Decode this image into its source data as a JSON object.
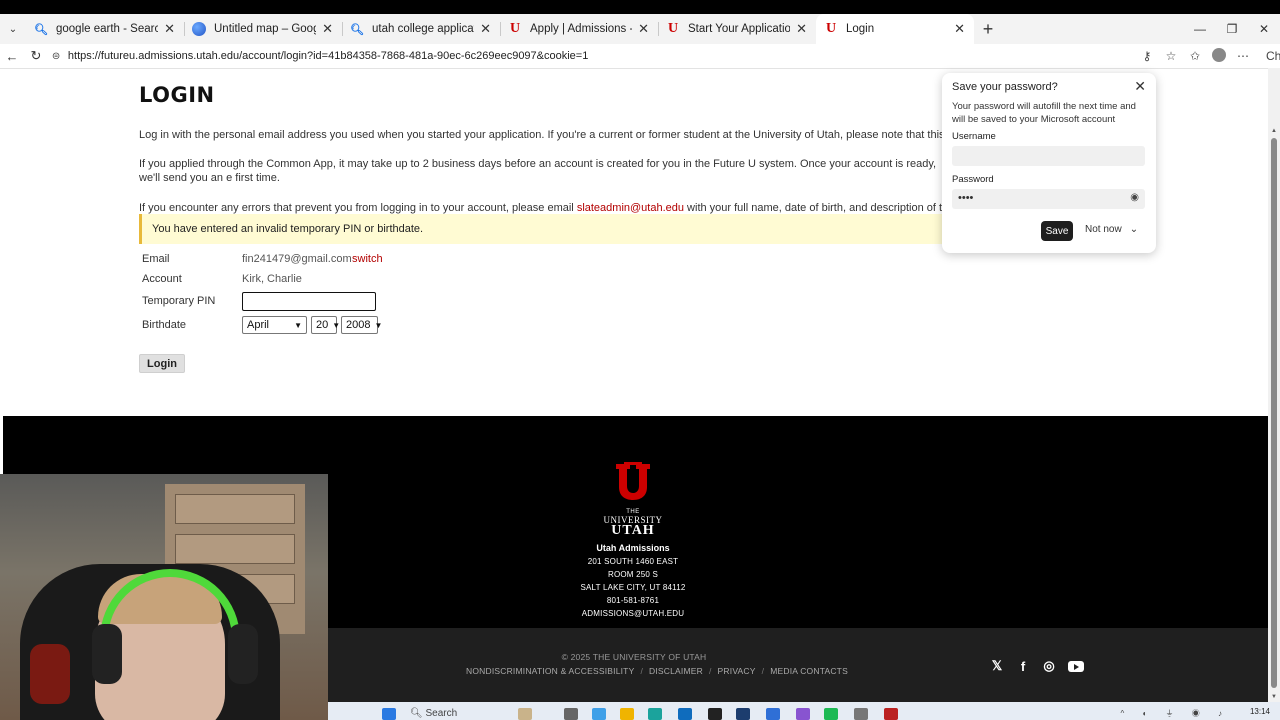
{
  "tabs": [
    {
      "title": "google earth - Search",
      "icon": "search-icon"
    },
    {
      "title": "Untitled map – Google Earth",
      "icon": "earth-icon"
    },
    {
      "title": "utah college application - Search",
      "icon": "search-icon"
    },
    {
      "title": "Apply | Admissions - The University",
      "icon": "utah-u-icon"
    },
    {
      "title": "Start Your Application",
      "icon": "utah-u-icon"
    },
    {
      "title": "Login",
      "icon": "utah-u-icon",
      "active": true
    }
  ],
  "browser": {
    "url": "https://futureu.admissions.utah.edu/account/login?id=41b84358-7868-481a-90ec-6c269eec9097&cookie=1",
    "chat_label": "Chat"
  },
  "page": {
    "title": "LOGIN",
    "p1": "Log in with the personal email address you used when you started your application. If you're a current or former student at the University of Utah, please note that this account is sepa",
    "p2": "If you applied through the Common App, it may take up to 2 business days before an account is created for you in the Future U system. Once your account is ready, we'll send you an e first time.",
    "p3_before": "If you encounter any errors that prevent you from logging in to your account, please email ",
    "p3_link": "slateadmin@utah.edu",
    "p3_after": " with your full name, date of birth, and description of the error to requ",
    "error": "You have entered an invalid temporary PIN or birthdate.",
    "form": {
      "email_label": "Email",
      "email_value": "fin241479@gmail.com",
      "switch_label": "switch",
      "account_label": "Account",
      "account_value": "Kirk, Charlie",
      "pin_label": "Temporary PIN",
      "pin_value": "",
      "birthdate_label": "Birthdate",
      "month": "April",
      "day": "20",
      "year": "2008",
      "login_label": "Login"
    }
  },
  "footer": {
    "logo_the": "THE",
    "logo_university": "UNIVERSITY",
    "logo_of_utah": "UTAH",
    "org": "Utah Admissions",
    "address1": "201 SOUTH 1460 EAST",
    "address2": "ROOM 250 S",
    "address3": "SALT LAKE CITY, UT 84112",
    "phone": "801-581-8761",
    "email": "ADMISSIONS@UTAH.EDU",
    "copyright": "© 2025 THE UNIVERSITY OF UTAH",
    "links": [
      "NONDISCRIMINATION & ACCESSIBILITY",
      "DISCLAIMER",
      "PRIVACY",
      "MEDIA CONTACTS"
    ],
    "socials": [
      "x-icon",
      "facebook-icon",
      "instagram-icon",
      "youtube-icon"
    ]
  },
  "password_popup": {
    "title": "Save your password?",
    "description": "Your password will autofill the next time and will be saved to your Microsoft account",
    "username_label": "Username",
    "username_value": "",
    "password_label": "Password",
    "password_value": "••••",
    "save_label": "Save",
    "not_now_label": "Not now"
  },
  "taskbar": {
    "search_label": "Search",
    "time": "13:14"
  },
  "colors": {
    "utah_red": "#cc0000",
    "link_red": "#b30000",
    "error_bg": "#fffbd3",
    "headset_green": "#4fd93a"
  }
}
